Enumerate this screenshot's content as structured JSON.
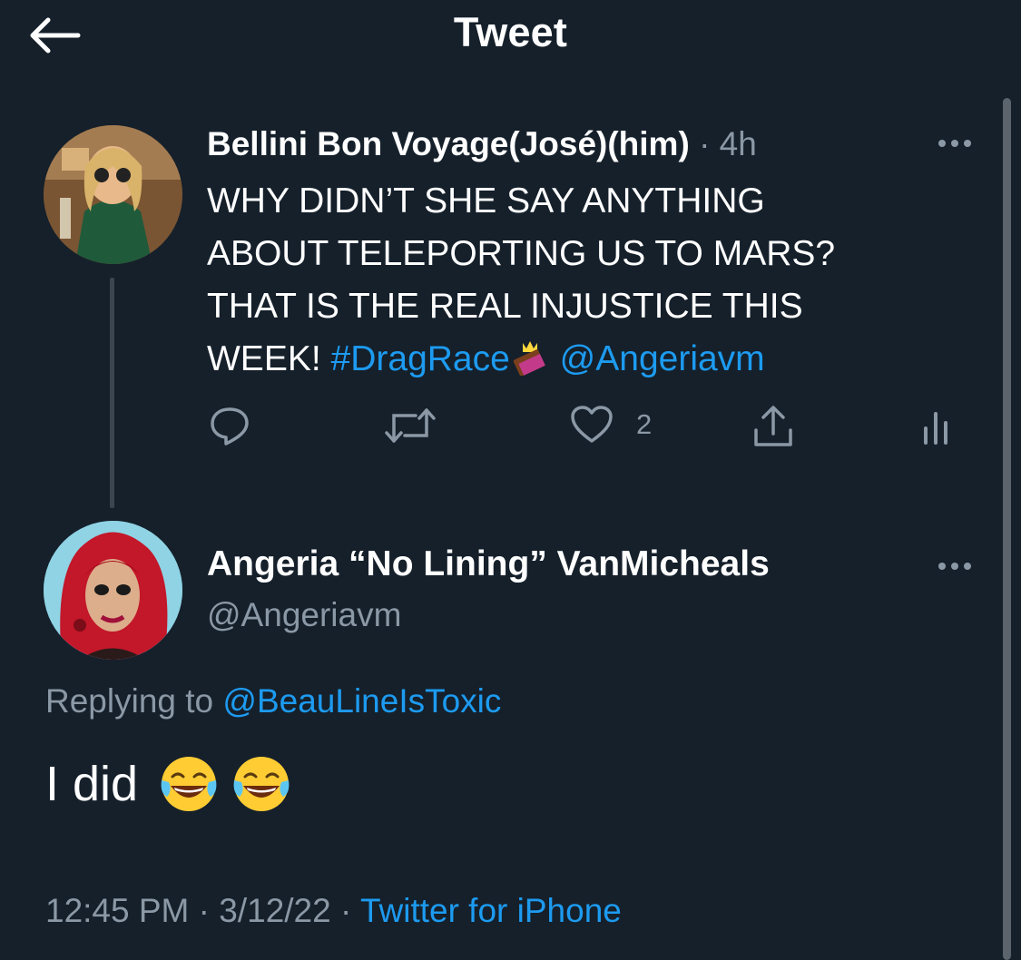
{
  "header": {
    "title": "Tweet",
    "back_icon": "arrow-left-icon"
  },
  "tweet1": {
    "name": "Bellini Bon Voyage(José)(him)",
    "separator": "·",
    "time": "4h",
    "text_line1": "WHY DIDN’T SHE SAY ANYTHING",
    "text_line2": "ABOUT TELEPORTING US TO MARS?",
    "text_line3": "THAT IS THE REAL INJUSTICE THIS",
    "text_line4_start": "WEEK! ",
    "hashtag": "#DragRace",
    "hashtag_emoji": "crown-chocolate-emoji",
    "mention": "@Angeriavm",
    "actions": {
      "reply_icon": "reply-icon",
      "retweet_icon": "retweet-icon",
      "like_icon": "heart-icon",
      "like_count": "2",
      "share_icon": "share-icon",
      "analytics_icon": "analytics-icon"
    }
  },
  "tweet2": {
    "name": "Angeria “No Lining” VanMicheals",
    "handle": "@Angeriavm",
    "replying_label": "Replying to ",
    "replying_handle": "@BeauLineIsToxic",
    "text": "I did",
    "emoji": "tears-of-joy-emoji",
    "footer_time": "12:45 PM",
    "footer_sep1": " · ",
    "footer_date": "3/12/22",
    "footer_sep2": " · ",
    "footer_source": "Twitter for iPhone"
  },
  "colors": {
    "background": "#15202b",
    "text": "#ffffff",
    "secondary": "#8b98a5",
    "accent": "#1d9bf0"
  }
}
